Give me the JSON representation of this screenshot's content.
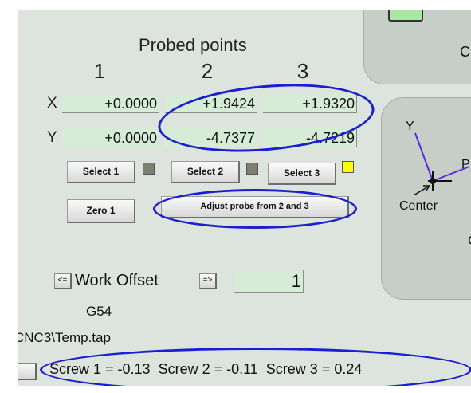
{
  "probed": {
    "title": "Probed points",
    "columns": [
      "1",
      "2",
      "3"
    ],
    "x_label": "X",
    "y_label": "Y",
    "x_values": [
      "+0.0000",
      "+1.9424",
      "+1.9320"
    ],
    "y_values": [
      "+0.0000",
      "-4.7377",
      "-4.7219"
    ]
  },
  "buttons": {
    "select1": "Select 1",
    "select2": "Select 2",
    "select3": "Select 3",
    "zero1": "Zero 1",
    "adjust": "Adjust probe from 2 and 3"
  },
  "leds": {
    "led1": "#7f7f6f",
    "led2": "#7f7f6f",
    "led3": "#ffff00"
  },
  "work_offset": {
    "prev": "<=",
    "label": "Work Offset",
    "next": "=>",
    "value": "1",
    "code": "G54"
  },
  "file_path": "CNC3\\Temp.tap",
  "screws": {
    "text": "Screw 1 = -0.13  Screw 2 = -0.11  Screw 3 = 0.24"
  },
  "right_panel": {
    "letter_c1": "C",
    "diagram_y": "Y",
    "diagram_p": "P",
    "diagram_center": "Center",
    "letter_c2": "C"
  },
  "colors": {
    "background": "#dde4dd",
    "field": "#d6ecd6",
    "annotation": "#1a1fd0",
    "accent_button": "#a8e8a0"
  }
}
